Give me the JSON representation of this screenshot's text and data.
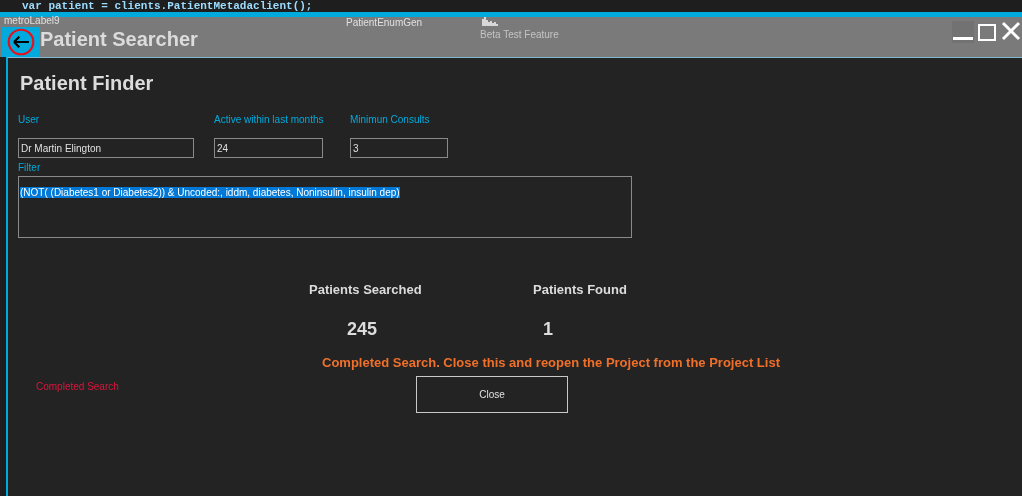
{
  "code_line": "var patient = clients.PatientMetadaclient();",
  "window": {
    "title": "Patient Searcher",
    "label": "metroLabel9",
    "enum_label": "PatientEnumGen",
    "beta_label": "Beta Test Feature"
  },
  "form": {
    "heading": "Patient Finder",
    "fields": [
      {
        "label": "User",
        "value": "Dr Martin Elington"
      },
      {
        "label": "Active within last months",
        "value": "24"
      },
      {
        "label": "Minimun Consults",
        "value": "3"
      }
    ],
    "filter": {
      "label": "Filter",
      "value": "(NOT( (Diabetes1 or Diabetes2)) & Uncoded:, iddm, diabetes, Noninsulin, insulin dep)",
      "selected": true
    }
  },
  "stats": [
    {
      "label": "Patients Searched",
      "value": "245"
    },
    {
      "label": "Patients Found",
      "value": "1"
    }
  ],
  "message": "Completed Search. Close this and reopen the Project from the Project List",
  "status": "Completed Search",
  "buttons": [
    "Close"
  ]
}
